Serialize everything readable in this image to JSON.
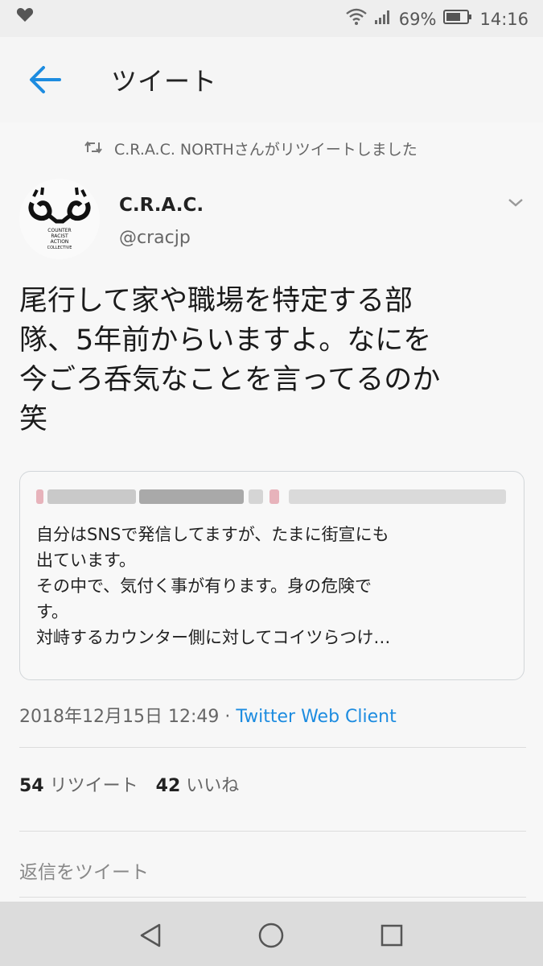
{
  "status_bar": {
    "battery": "69%",
    "time": "14:16"
  },
  "app_bar": {
    "title": "ツイート"
  },
  "retweet_notice": "C.R.A.C. NORTHさんがリツイートしました",
  "tweet": {
    "author_name": "C.R.A.C.",
    "author_handle": "@cracjp",
    "avatar_text": [
      "COUNTER",
      "RACIST",
      "ACTION",
      "COLLECTIVE"
    ],
    "text_lines": [
      "尾行して家や職場を特定する部",
      "隊、5年前からいますよ。なにを",
      "今ごろ呑気なことを言ってるのか",
      "笑"
    ],
    "timestamp": "2018年12月15日 12:49",
    "separator": " · ",
    "client": "Twitter Web Client"
  },
  "quote": {
    "text_lines": [
      "自分はSNSで発信してますが、たまに街宣にも",
      "出ています。",
      "その中で、気付く事が有ります。身の危険で",
      "す。",
      "対峙するカウンター側に対してコイツらつけ…"
    ]
  },
  "stats": {
    "retweets_count": "54",
    "retweets_label": "リツイート",
    "likes_count": "42",
    "likes_label": "いいね"
  },
  "reply": {
    "placeholder": "返信をツイート"
  },
  "colors": {
    "accent": "#1d8ce0",
    "text": "#1b1b1b",
    "muted": "#666666"
  }
}
